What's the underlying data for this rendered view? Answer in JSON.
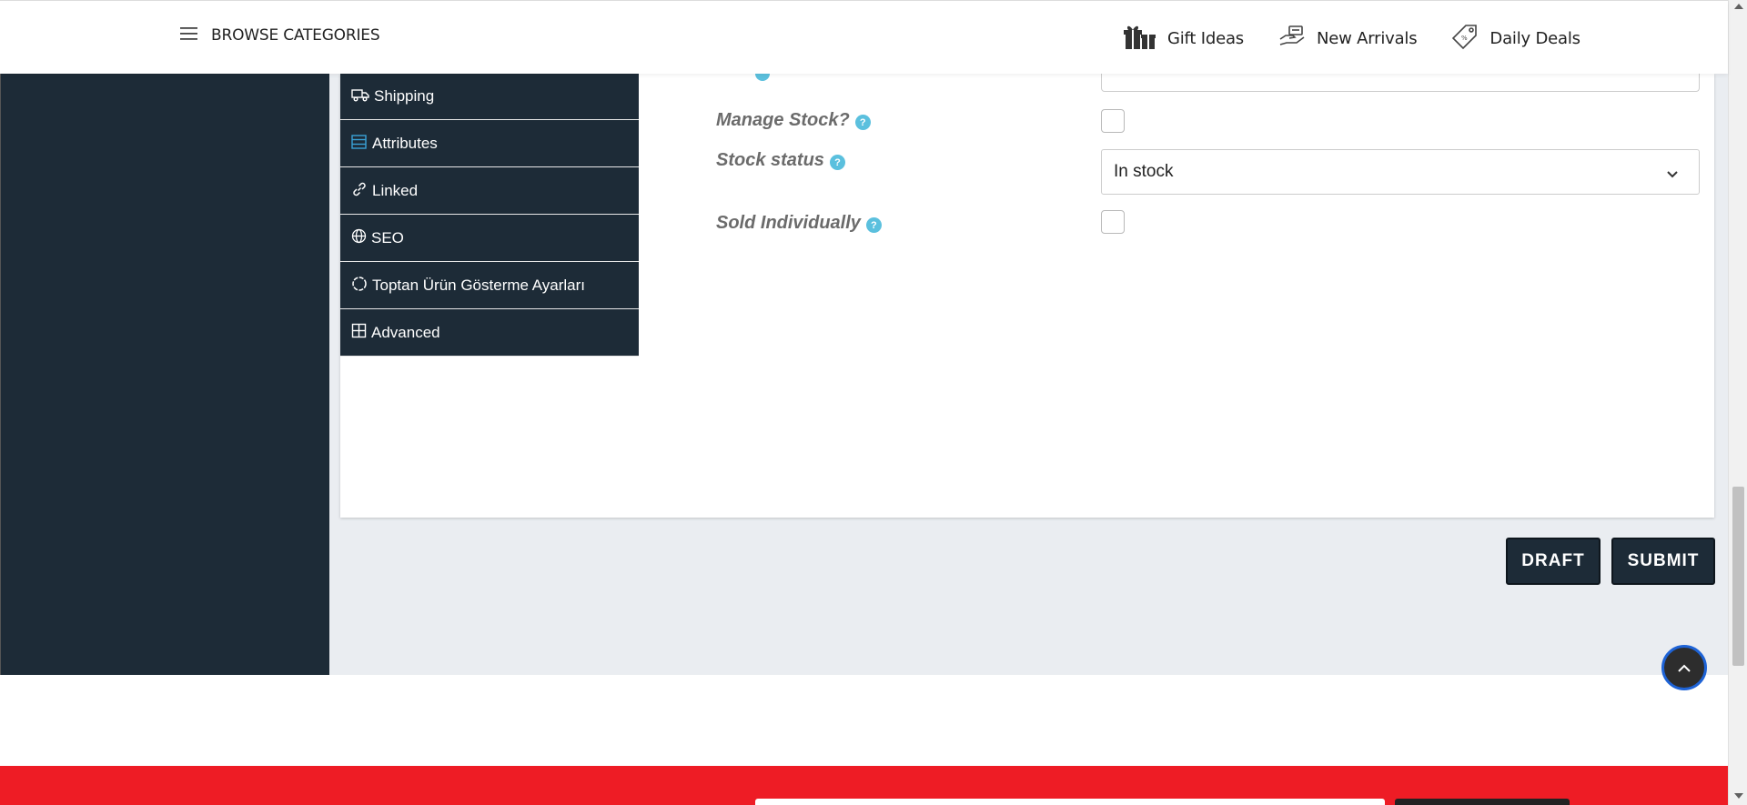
{
  "header": {
    "browse_label": "BROWSE CATEGORIES",
    "nav": [
      {
        "label": "Gift Ideas",
        "icon": "gift-icon"
      },
      {
        "label": "New Arrivals",
        "icon": "new-arrivals-icon"
      },
      {
        "label": "Daily Deals",
        "icon": "price-tag-icon"
      }
    ]
  },
  "tabs": [
    {
      "label": "Shipping",
      "icon": "truck-icon"
    },
    {
      "label": "Attributes",
      "icon": "list-icon"
    },
    {
      "label": "Linked",
      "icon": "link-icon"
    },
    {
      "label": "SEO",
      "icon": "globe-icon"
    },
    {
      "label": "Toptan Ürün Gösterme Ayarları",
      "icon": "circle-dashed-icon"
    },
    {
      "label": "Advanced",
      "icon": "grid-icon"
    }
  ],
  "form": {
    "manage_stock_label": "Manage Stock?",
    "stock_status_label": "Stock status",
    "stock_status_value": "In stock",
    "sold_individually_label": "Sold Individually",
    "help_glyph": "?"
  },
  "buttons": {
    "draft": "DRAFT",
    "submit": "SUBMIT"
  },
  "colors": {
    "dark_navy": "#1d2b37",
    "help_blue": "#5bc0de",
    "footer_red": "#ee1c25",
    "dashboard_bg": "#eaedf1"
  }
}
